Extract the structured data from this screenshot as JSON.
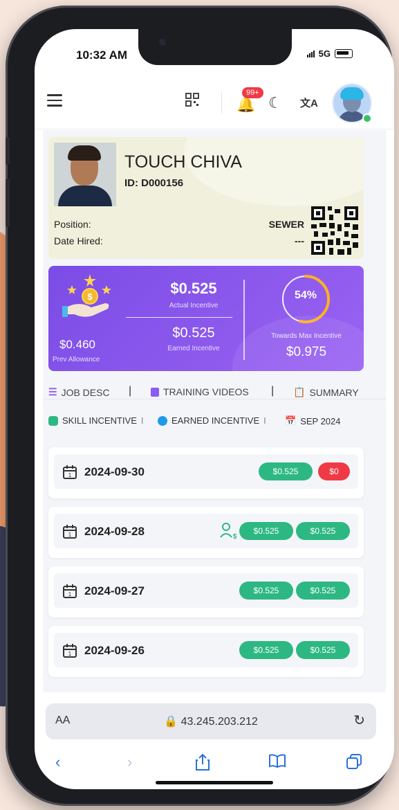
{
  "status_bar": {
    "time": "10:32 AM",
    "network": "5G"
  },
  "header": {
    "notification_badge": "99+"
  },
  "profile": {
    "name": "TOUCH CHIVA",
    "id_line": "ID: D000156",
    "position_label": "Position:",
    "position_value": "SEWER",
    "date_hired_label": "Date Hired:",
    "date_hired_value": "---"
  },
  "incentive": {
    "actual_value": "$0.525",
    "actual_label": "Actual Incentive",
    "earned_value": "$0.525",
    "earned_label": "Earned Incentive",
    "prev_value": "$0.460",
    "prev_label": "Prev Allowance",
    "percent_text": "54%",
    "percent": 54,
    "towards_label": "Towards Max Incentive",
    "max_value": "$0.975"
  },
  "tabs": [
    "JOB DESC",
    "TRAINING VIDEOS",
    "SUMMARY"
  ],
  "legend": {
    "skill": "SKILL INCENTIVE",
    "earned": "EARNED INCENTIVE",
    "month": "SEP 2024",
    "skill_color": "#2db883",
    "earned_color": "#1e9ae8"
  },
  "days": [
    {
      "date": "2024-09-30",
      "skill": "$0.525",
      "earned": "$0"
    },
    {
      "date": "2024-09-28",
      "skill": "$0.525",
      "earned": "$0.525"
    },
    {
      "date": "2024-09-27",
      "skill": "$0.525",
      "earned": "$0.525"
    },
    {
      "date": "2024-09-26",
      "skill": "$0.525",
      "earned": "$0.525"
    }
  ],
  "browser": {
    "aa": "AA",
    "url": "43.245.203.212"
  },
  "colors": {
    "purple": "#8653ec",
    "green": "#2db883",
    "red": "#ef3a45"
  }
}
